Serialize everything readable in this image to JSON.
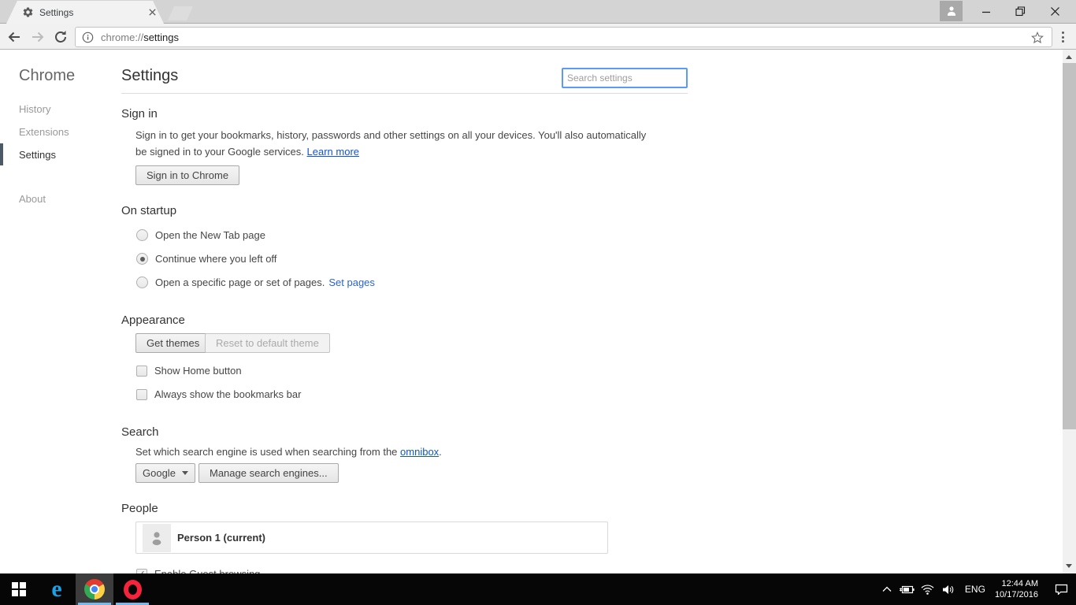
{
  "window": {
    "tab_title": "Settings",
    "url_scheme": "chrome://",
    "url_path": "settings"
  },
  "sidebar": {
    "product": "Chrome",
    "items": [
      {
        "label": "History"
      },
      {
        "label": "Extensions"
      },
      {
        "label": "Settings",
        "selected": true
      },
      {
        "label": "About"
      }
    ]
  },
  "page": {
    "title": "Settings",
    "search_placeholder": "Search settings"
  },
  "sections": {
    "sign_in": {
      "heading": "Sign in",
      "line1": "Sign in to get your bookmarks, history, passwords and other settings on all your devices. You'll also automatically",
      "line2": "be signed in to your Google services.",
      "learn_more": "Learn more",
      "button": "Sign in to Chrome"
    },
    "on_startup": {
      "heading": "On startup",
      "options": [
        {
          "label": "Open the New Tab page",
          "checked": false
        },
        {
          "label": "Continue where you left off",
          "checked": true
        },
        {
          "label": "Open a specific page or set of pages.",
          "checked": false,
          "link": "Set pages"
        }
      ]
    },
    "appearance": {
      "heading": "Appearance",
      "get_themes": "Get themes",
      "reset_theme": "Reset to default theme",
      "checkboxes": [
        {
          "label": "Show Home button",
          "checked": false
        },
        {
          "label": "Always show the bookmarks bar",
          "checked": false
        }
      ]
    },
    "search": {
      "heading": "Search",
      "desc_before": "Set which search engine is used when searching from the ",
      "link": "omnibox",
      "desc_after": ".",
      "engine": "Google",
      "manage_button": "Manage search engines..."
    },
    "people": {
      "heading": "People",
      "person": "Person 1 (current)",
      "guest_checkbox": "Enable Guest browsing",
      "guest_checked": "✓"
    }
  },
  "taskbar": {
    "lang": "ENG",
    "time": "12:44 AM",
    "date": "10/17/2016"
  },
  "icons": {
    "edge_glyph": "e"
  },
  "colors": {
    "accent_focus": "#5a9af8",
    "link": "#1155cc",
    "nav_indicator": "#4c5a67",
    "taskbar_underline": "#76b9ed",
    "active_tab": "#f2f2f2",
    "tab_strip": "#d4d4d4"
  }
}
